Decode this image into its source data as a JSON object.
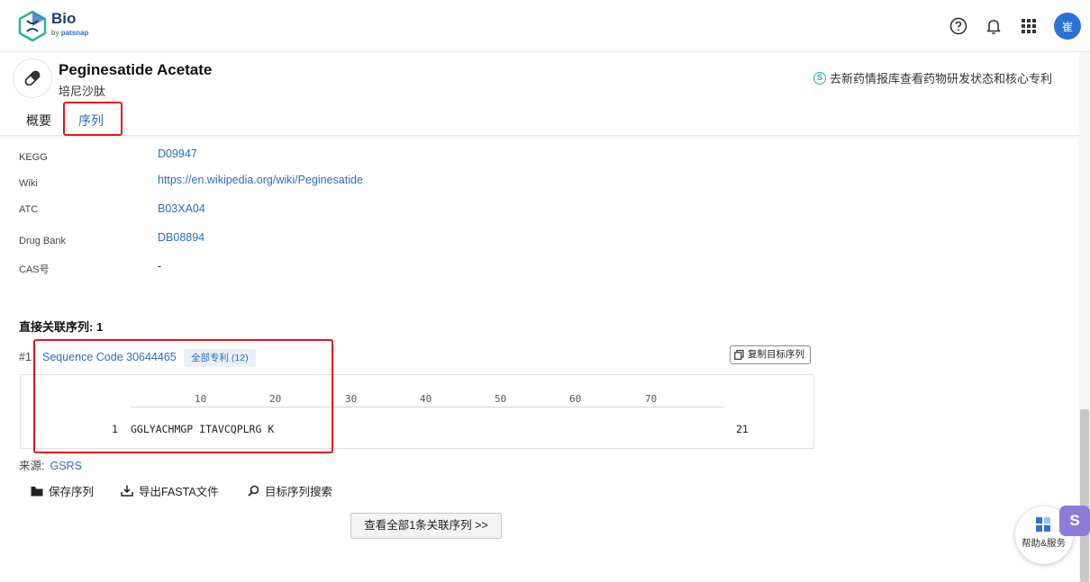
{
  "app": {
    "logo_name": "Bio",
    "logo_by": "by",
    "logo_brand": "patsnap",
    "avatar_initial": "崔",
    "icons": [
      "help-icon",
      "bell-icon",
      "apps-grid-icon"
    ]
  },
  "drug": {
    "name_en": "Peginesatide Acetate",
    "name_cn": "培尼沙肽",
    "external_link": "去新药情报库查看药物研发状态和核心专利"
  },
  "tabs": [
    {
      "label": "概要",
      "active": false
    },
    {
      "label": "序列",
      "active": true
    }
  ],
  "identifiers": [
    {
      "label": "KEGG",
      "value": "D09947",
      "link": true
    },
    {
      "label": "Wiki",
      "value": "https://en.wikipedia.org/wiki/Peginesatide",
      "link": true
    },
    {
      "label": "ATC",
      "value": "B03XA04",
      "link": true
    },
    {
      "label": "Drug Bank",
      "value": "DB08894",
      "link": true
    },
    {
      "label": "CAS号",
      "value": "-",
      "link": false
    }
  ],
  "sequences": {
    "section_title": "直接关联序列: 1",
    "item": {
      "index": "#1",
      "code": "Sequence Code 30644465",
      "patent_tag": "全部专利 (12)",
      "copy_label": "复制目标序列",
      "ruler": [
        "10",
        "20",
        "30",
        "40",
        "50",
        "60",
        "70"
      ],
      "line_start": "1",
      "residues": "GGLYACHMGP ITAVCQPLRG K",
      "line_end": "21"
    },
    "source_label": "来源:",
    "source_value": "GSRS",
    "actions": {
      "save": "保存序列",
      "export": "导出FASTA文件",
      "search": "目标序列搜索"
    },
    "view_all": "查看全部1条关联序列 >>"
  },
  "widget": {
    "help_label": "帮助&服务",
    "s_badge": "S"
  },
  "colors": {
    "link": "#2b6cc4",
    "highlight": "#e8141d",
    "avatar": "#2b71d8"
  }
}
